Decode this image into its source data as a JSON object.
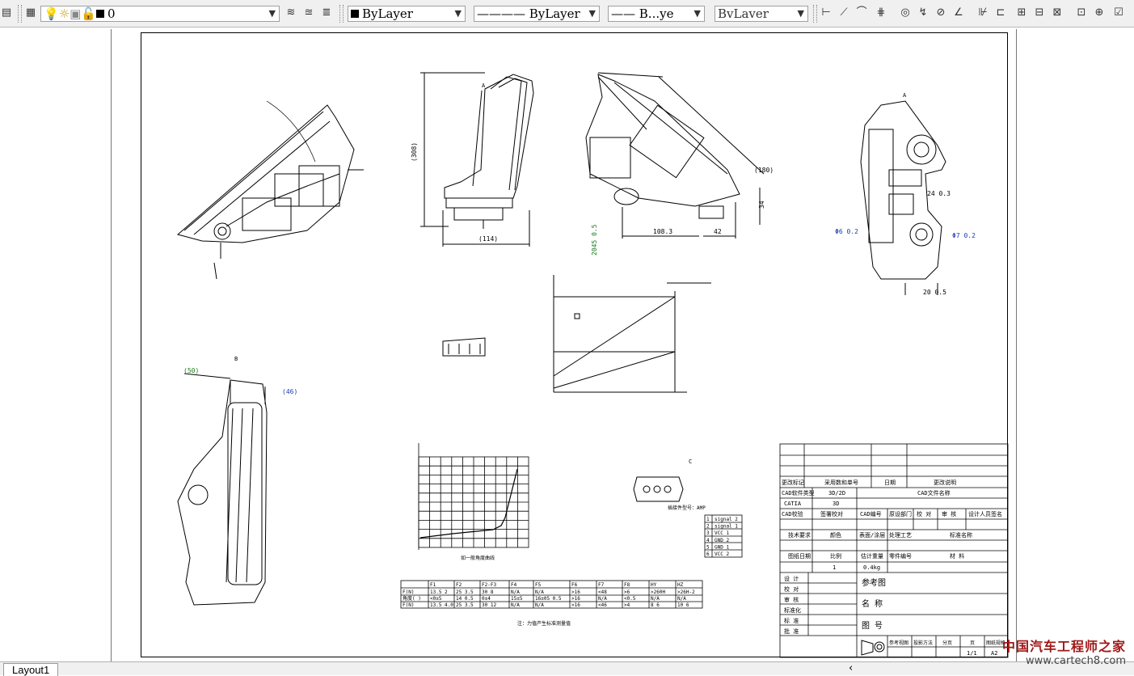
{
  "toolbar": {
    "layer_name": "0",
    "color_value": "ByLayer",
    "linetype_value": "ByLayer",
    "lineweight_value": "B...ye",
    "plotstyle_value": "BvLaver"
  },
  "tabs": {
    "layout_tab": "Layout1"
  },
  "drawing": {
    "dim_308": "(308)",
    "dim_114": "(114)",
    "dim_180": "(180)",
    "dim_108": "108.3",
    "dim_42": "42",
    "dim_34": "34",
    "dim_20": "20",
    "dim_50": "(50)",
    "dim_46": "(46)",
    "tol_24": "24  0.3",
    "tol_phi6": "Φ6  0.2",
    "tol_phi7": "Φ7  0.2",
    "tol_20": "20  0.5",
    "tol_2045": "2045  0.5",
    "view_a": "A",
    "view_b": "B",
    "view_c": "C",
    "note_bottom": "注：力值产生标准测量值",
    "chart_note": "如一般角度曲线",
    "connector_note": "插接件型号：AMP"
  },
  "force_table": {
    "headers": [
      "",
      "F1",
      "F2",
      "F2-F3",
      "F4",
      "F5",
      "F6",
      "F7",
      "F8",
      "HY",
      "HZ"
    ],
    "rows": [
      [
        "F(N)",
        "13.5  2",
        "25  3.5",
        "30  8",
        "N/A",
        "N/A",
        ">16",
        "<48",
        ">6",
        ">260H",
        ">26H-2"
      ],
      [
        "角度( )",
        "<0±5",
        "14  0.5",
        "0±4",
        "15±5",
        "16±05  0.5",
        ">16",
        "N/A",
        "<0.5",
        "N/A",
        "N/A"
      ],
      [
        "F(N)",
        "13.5  4.0",
        "25  3.5",
        "30  12",
        "N/A",
        "N/A",
        ">16",
        "<46",
        ">4",
        "8  6",
        "10  6"
      ]
    ]
  },
  "pin_table": {
    "rows": [
      [
        "1",
        "signal 2"
      ],
      [
        "2",
        "signal 1"
      ],
      [
        "3",
        "VCC 1"
      ],
      [
        "4",
        "GND 2"
      ],
      [
        "5",
        "GND 1"
      ],
      [
        "6",
        "VCC 2"
      ]
    ]
  },
  "title_block": {
    "row1": [
      "更改标记",
      "采用数和单号",
      "日期",
      "更改说明"
    ],
    "row2": [
      "CAD软件类型",
      "3D/2D",
      "CAD文件名称"
    ],
    "row3": [
      "CATIA",
      "3D",
      ""
    ],
    "row4": [
      "CAD校验",
      "签署校对",
      "CAD编号",
      "原设部门",
      "校  对",
      "审  核",
      "设计人员签名"
    ],
    "row5": [
      "技术要求",
      "颜色",
      "表面/涂层",
      "处理工艺",
      "标准件",
      "标准名称"
    ],
    "row6": [
      "图纸日期",
      "比例",
      "估计重量",
      "零件编号",
      "材  料"
    ],
    "row7": [
      "",
      "1",
      "0.4kg",
      "",
      ""
    ],
    "left_labels": [
      "设  计",
      "校  对",
      "审  核",
      "标准化",
      "标  准",
      "批  准"
    ],
    "ref_label": "参考图",
    "name_label": "名  称",
    "no_label": "图  号",
    "bottom": [
      "参考视图",
      "投影方法",
      "分页",
      "页",
      "图纸规格"
    ],
    "bottom_values": [
      "",
      "",
      "",
      "1/1",
      "A2"
    ]
  },
  "watermark": {
    "line1": "中国汽车工程师之家",
    "line2": "www.cartech8.com"
  },
  "colors": {
    "toolbar_bg": "#f0f0f0",
    "green_dim": "#1a7a1a",
    "blue_dim": "#1a3ab0"
  }
}
